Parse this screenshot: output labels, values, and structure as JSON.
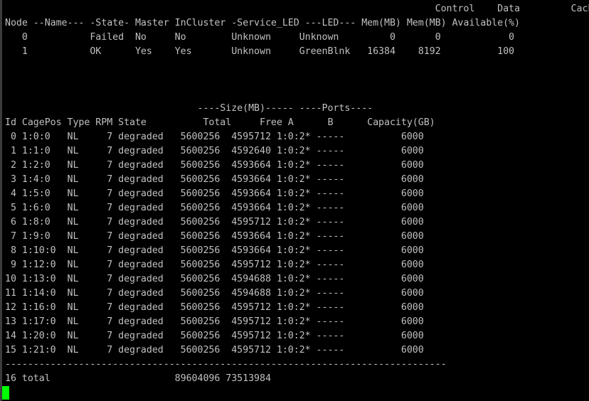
{
  "terminal": {
    "lines": [
      "                                                                            Control    Data         Cache",
      "Node --Name--- -State- Master InCluster -Service_LED ---LED--- Mem(MB) Mem(MB) Available(%)",
      "   0           Failed  No     No        Unknown     Unknown         0       0            0",
      "   1           OK      Yes    Yes       Unknown     GreenBlnk   16384    8192          100",
      "",
      "",
      "",
      "                                  ----Size(MB)----- ----Ports----",
      "Id CagePos Type RPM State          Total     Free A      B      Capacity(GB)",
      " 0 1:0:0   NL     7 degraded   5600256  4595712 1:0:2* -----          6000",
      " 1 1:1:0   NL     7 degraded   5600256  4592640 1:0:2* -----          6000",
      " 2 1:2:0   NL     7 degraded   5600256  4593664 1:0:2* -----          6000",
      " 3 1:4:0   NL     7 degraded   5600256  4593664 1:0:2* -----          6000",
      " 4 1:5:0   NL     7 degraded   5600256  4593664 1:0:2* -----          6000",
      " 5 1:6:0   NL     7 degraded   5600256  4593664 1:0:2* -----          6000",
      " 6 1:8:0   NL     7 degraded   5600256  4595712 1:0:2* -----          6000",
      " 7 1:9:0   NL     7 degraded   5600256  4593664 1:0:2* -----          6000",
      " 8 1:10:0  NL     7 degraded   5600256  4593664 1:0:2* -----          6000",
      " 9 1:12:0  NL     7 degraded   5600256  4595712 1:0:2* -----          6000",
      "10 1:13:0  NL     7 degraded   5600256  4594688 1:0:2* -----          6000",
      "11 1:14:0  NL     7 degraded   5600256  4594688 1:0:2* -----          6000",
      "12 1:16:0  NL     7 degraded   5600256  4595712 1:0:2* -----          6000",
      "13 1:17:0  NL     7 degraded   5600256  4595712 1:0:2* -----          6000",
      "14 1:20:0  NL     7 degraded   5600256  4595712 1:0:2* -----          6000",
      "15 1:21:0  NL     7 degraded   5600256  4595712 1:0:2* -----          6000",
      "------------------------------------------------------------------------------",
      "16 total                      89604096 73513984"
    ]
  },
  "colors": {
    "background": "#000000",
    "text": "#c0c0c0",
    "cursor": "#00ff00"
  }
}
